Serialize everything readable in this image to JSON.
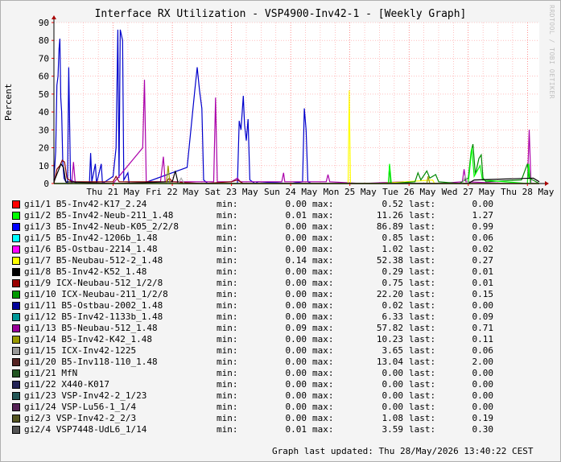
{
  "chart_data": {
    "type": "line",
    "title": "Interface RX Utilization - VSP4900-Inv42-1 - [Weekly Graph]",
    "ylabel": "Percent",
    "ylim": [
      0,
      90
    ],
    "yticks": [
      0,
      10,
      20,
      30,
      40,
      50,
      60,
      70,
      80,
      90
    ],
    "xlim": [
      0,
      8.2
    ],
    "x_unit": "days since Wed 20 May 2026 00:00",
    "xticks": [
      {
        "x": 1,
        "label": "Thu 21 May"
      },
      {
        "x": 2,
        "label": "Fri 22 May"
      },
      {
        "x": 3,
        "label": "Sat 23 May"
      },
      {
        "x": 4,
        "label": "Sun 24 May"
      },
      {
        "x": 5,
        "label": "Mon 25 May"
      },
      {
        "x": 6,
        "label": "Tue 26 May"
      },
      {
        "x": 7,
        "label": "Wed 27 May"
      },
      {
        "x": 8,
        "label": "Thu 28 May"
      }
    ],
    "grid": true,
    "watermark": "RRDTOOL / TOBI OETIKER",
    "series_visible": [
      {
        "name": "gi1/3",
        "color": "#0000cc",
        "points": [
          [
            0.0,
            2
          ],
          [
            0.03,
            18
          ],
          [
            0.05,
            55
          ],
          [
            0.07,
            60
          ],
          [
            0.085,
            75
          ],
          [
            0.1,
            81
          ],
          [
            0.115,
            48
          ],
          [
            0.13,
            40
          ],
          [
            0.15,
            12
          ],
          [
            0.17,
            3
          ],
          [
            0.2,
            1
          ],
          [
            0.23,
            0
          ],
          [
            0.25,
            65
          ],
          [
            0.28,
            2
          ],
          [
            0.4,
            0
          ],
          [
            0.6,
            0
          ],
          [
            0.62,
            17
          ],
          [
            0.64,
            1
          ],
          [
            0.7,
            11
          ],
          [
            0.72,
            0
          ],
          [
            0.8,
            11
          ],
          [
            0.82,
            0
          ],
          [
            1.0,
            4
          ],
          [
            1.05,
            20
          ],
          [
            1.08,
            86
          ],
          [
            1.1,
            3
          ],
          [
            1.12,
            86
          ],
          [
            1.16,
            80
          ],
          [
            1.18,
            2
          ],
          [
            1.25,
            6
          ],
          [
            1.27,
            0
          ],
          [
            1.5,
            0
          ],
          [
            2.25,
            9
          ],
          [
            2.38,
            52
          ],
          [
            2.42,
            65
          ],
          [
            2.46,
            52
          ],
          [
            2.5,
            42
          ],
          [
            2.53,
            2
          ],
          [
            2.6,
            0
          ],
          [
            3.1,
            0
          ],
          [
            3.13,
            35
          ],
          [
            3.16,
            30
          ],
          [
            3.2,
            49
          ],
          [
            3.22,
            33
          ],
          [
            3.25,
            24
          ],
          [
            3.28,
            36
          ],
          [
            3.31,
            2
          ],
          [
            3.4,
            0
          ],
          [
            3.45,
            1
          ],
          [
            4.0,
            0
          ],
          [
            4.2,
            1
          ],
          [
            4.23,
            42
          ],
          [
            4.26,
            30
          ],
          [
            4.29,
            1
          ],
          [
            4.35,
            0
          ],
          [
            5.2,
            0
          ],
          [
            6.2,
            0
          ],
          [
            7.5,
            0
          ],
          [
            8.2,
            0
          ]
        ]
      },
      {
        "name": "gi1/13",
        "color": "#aa00aa",
        "points": [
          [
            0.0,
            0
          ],
          [
            0.3,
            0
          ],
          [
            0.33,
            12
          ],
          [
            0.36,
            0
          ],
          [
            1.0,
            0
          ],
          [
            1.5,
            20
          ],
          [
            1.53,
            58
          ],
          [
            1.56,
            1
          ],
          [
            1.8,
            1
          ],
          [
            1.85,
            15
          ],
          [
            1.88,
            1
          ],
          [
            2.3,
            1
          ],
          [
            2.7,
            1
          ],
          [
            2.73,
            48
          ],
          [
            2.76,
            1
          ],
          [
            3.0,
            1
          ],
          [
            3.1,
            3
          ],
          [
            3.15,
            1
          ],
          [
            3.85,
            1
          ],
          [
            3.88,
            6
          ],
          [
            3.9,
            1
          ],
          [
            4.6,
            1
          ],
          [
            4.63,
            5
          ],
          [
            4.66,
            1
          ],
          [
            5.2,
            0
          ],
          [
            5.9,
            1
          ],
          [
            6.0,
            0
          ],
          [
            6.5,
            0
          ],
          [
            6.9,
            1
          ],
          [
            6.93,
            8
          ],
          [
            6.96,
            1
          ],
          [
            7.7,
            0
          ],
          [
            8.0,
            0
          ],
          [
            8.03,
            30
          ],
          [
            8.06,
            0
          ],
          [
            8.2,
            0
          ]
        ]
      },
      {
        "name": "gi1/7",
        "color": "#ffff00",
        "points": [
          [
            0.0,
            0
          ],
          [
            4.97,
            0
          ],
          [
            4.99,
            52
          ],
          [
            5.01,
            0
          ],
          [
            5.5,
            0
          ],
          [
            6.4,
            2
          ],
          [
            6.43,
            0
          ],
          [
            8.2,
            0
          ]
        ]
      },
      {
        "name": "gi1/10",
        "color": "#008800",
        "points": [
          [
            0.0,
            0
          ],
          [
            5.65,
            0
          ],
          [
            5.67,
            10
          ],
          [
            5.69,
            0
          ],
          [
            6.1,
            1
          ],
          [
            6.15,
            6
          ],
          [
            6.2,
            2
          ],
          [
            6.3,
            7
          ],
          [
            6.35,
            3
          ],
          [
            6.45,
            5
          ],
          [
            6.5,
            1
          ],
          [
            6.85,
            0
          ],
          [
            7.0,
            3
          ],
          [
            7.05,
            18
          ],
          [
            7.08,
            22
          ],
          [
            7.12,
            5
          ],
          [
            7.18,
            14
          ],
          [
            7.22,
            16
          ],
          [
            7.25,
            3
          ],
          [
            7.3,
            1
          ],
          [
            7.9,
            2
          ],
          [
            8.0,
            11
          ],
          [
            8.03,
            3
          ],
          [
            8.2,
            0
          ]
        ]
      },
      {
        "name": "gi1/2",
        "color": "#00ff00",
        "points": [
          [
            0.0,
            0
          ],
          [
            5.65,
            0
          ],
          [
            5.67,
            11
          ],
          [
            5.7,
            0
          ],
          [
            7.0,
            0
          ],
          [
            7.06,
            20
          ],
          [
            7.1,
            4
          ],
          [
            7.2,
            10
          ],
          [
            7.24,
            2
          ],
          [
            8.0,
            0
          ],
          [
            8.02,
            11
          ],
          [
            8.05,
            0
          ],
          [
            8.2,
            0
          ]
        ]
      },
      {
        "name": "gi1/9",
        "color": "#880000",
        "points": [
          [
            0.0,
            0
          ],
          [
            0.05,
            8
          ],
          [
            0.1,
            10
          ],
          [
            0.14,
            13
          ],
          [
            0.18,
            12
          ],
          [
            0.22,
            3
          ],
          [
            0.3,
            1
          ],
          [
            1.0,
            1
          ],
          [
            1.05,
            4
          ],
          [
            1.1,
            1
          ],
          [
            1.9,
            1
          ],
          [
            1.95,
            3
          ],
          [
            2.0,
            1
          ],
          [
            2.5,
            0
          ],
          [
            3.0,
            1
          ],
          [
            3.1,
            2
          ],
          [
            3.2,
            0
          ],
          [
            8.2,
            0
          ]
        ]
      },
      {
        "name": "gi1/8",
        "color": "#000000",
        "points": [
          [
            0.0,
            1
          ],
          [
            0.12,
            11
          ],
          [
            0.16,
            9
          ],
          [
            0.2,
            1
          ],
          [
            1.0,
            0
          ],
          [
            2.0,
            1
          ],
          [
            2.05,
            7
          ],
          [
            2.1,
            0
          ],
          [
            7.0,
            0
          ],
          [
            7.1,
            2
          ],
          [
            8.1,
            3
          ],
          [
            8.2,
            1
          ]
        ]
      },
      {
        "name": "gi1/14",
        "color": "#999900",
        "points": [
          [
            0.0,
            0
          ],
          [
            1.9,
            0
          ],
          [
            1.93,
            10
          ],
          [
            1.96,
            0
          ],
          [
            2.8,
            0
          ],
          [
            6.3,
            0
          ],
          [
            6.32,
            4
          ],
          [
            6.35,
            0
          ],
          [
            8.2,
            0
          ]
        ]
      },
      {
        "name": "gi1/15",
        "color": "#aaaaaa",
        "points": [
          [
            0.0,
            0
          ],
          [
            2.1,
            0
          ],
          [
            2.15,
            3
          ],
          [
            2.2,
            0
          ],
          [
            6.9,
            0
          ],
          [
            6.95,
            4
          ],
          [
            7.0,
            0
          ],
          [
            8.2,
            0
          ]
        ]
      }
    ]
  },
  "legend": [
    {
      "color": "#ff0000",
      "name": "gi1/1 B5-Inv42-K17_2.24",
      "min": "0.00",
      "max": "0.52",
      "last": "0.00"
    },
    {
      "color": "#00ff00",
      "name": "gi1/2 B5-Inv42-Neub-211_1.48",
      "min": "0.01",
      "max": "11.26",
      "last": "1.27"
    },
    {
      "color": "#0000ff",
      "name": "gi1/3 B5-Inv42-Neub-K05_2/2/8",
      "min": "0.00",
      "max": "86.89",
      "last": "0.99"
    },
    {
      "color": "#00ffff",
      "name": "gi1/5 B5-Inv42-1206b_1.48",
      "min": "0.00",
      "max": "0.85",
      "last": "0.06"
    },
    {
      "color": "#ff00ff",
      "name": "gi1/6 B5-Ostbau-2214_1.48",
      "min": "0.00",
      "max": "1.02",
      "last": "0.02"
    },
    {
      "color": "#ffff00",
      "name": "gi1/7 B5-Neubau-512-2_1.48",
      "min": "0.14",
      "max": "52.38",
      "last": "0.27"
    },
    {
      "color": "#000000",
      "name": "gi1/8 B5-Inv42-K52_1.48",
      "min": "0.00",
      "max": "0.29",
      "last": "0.01"
    },
    {
      "color": "#990000",
      "name": "gi1/9 ICX-Neubau-512_1/2/8",
      "min": "0.00",
      "max": "0.75",
      "last": "0.01"
    },
    {
      "color": "#009900",
      "name": "gi1/10 ICX-Neubau-211_1/2/8",
      "min": "0.00",
      "max": "22.20",
      "last": "0.15"
    },
    {
      "color": "#000099",
      "name": "gi1/11 B5-Ostbau-2002_1.48",
      "min": "0.00",
      "max": "0.02",
      "last": "0.00"
    },
    {
      "color": "#009999",
      "name": "gi1/12 B5-Inv42-1133b_1.48",
      "min": "0.00",
      "max": "6.33",
      "last": "0.09"
    },
    {
      "color": "#990099",
      "name": "gi1/13 B5-Neubau-512_1.48",
      "min": "0.09",
      "max": "57.82",
      "last": "0.71"
    },
    {
      "color": "#999900",
      "name": "gi1/14 B5-Inv42-K42_1.48",
      "min": "0.00",
      "max": "10.23",
      "last": "0.11"
    },
    {
      "color": "#999999",
      "name": "gi1/15 ICX-Inv42-1225",
      "min": "0.00",
      "max": "3.65",
      "last": "0.06"
    },
    {
      "color": "#552222",
      "name": "gi1/20 B5-Inv118-110_1.48",
      "min": "0.00",
      "max": "13.04",
      "last": "2.00"
    },
    {
      "color": "#225522",
      "name": "gi1/21 MfN",
      "min": "0.00",
      "max": "0.00",
      "last": "0.00"
    },
    {
      "color": "#222255",
      "name": "gi1/22 X440-K017",
      "min": "0.00",
      "max": "0.00",
      "last": "0.00"
    },
    {
      "color": "#225555",
      "name": "gi1/23 VSP-Inv42-2_1/23",
      "min": "0.00",
      "max": "0.00",
      "last": "0.00"
    },
    {
      "color": "#552255",
      "name": "gi1/24 VSP-Lu56-1_1/4",
      "min": "0.00",
      "max": "0.00",
      "last": "0.00"
    },
    {
      "color": "#555522",
      "name": "gi2/3 VSP-Inv42-2_2/3",
      "min": "0.00",
      "max": "1.08",
      "last": "0.19"
    },
    {
      "color": "#555555",
      "name": "gi2/4 VSP7448-UdL6_1/14",
      "min": "0.01",
      "max": "3.59",
      "last": "0.30"
    }
  ],
  "labels": {
    "min": "min:",
    "max": "max:",
    "last": "last:"
  },
  "updated": "Graph last updated: Thu 28/May/2026 13:40:22 CEST",
  "colors": {
    "background": "#f4f4f4",
    "canvas": "#ffffff",
    "grid": "#ff9999",
    "axis": "#000000"
  }
}
